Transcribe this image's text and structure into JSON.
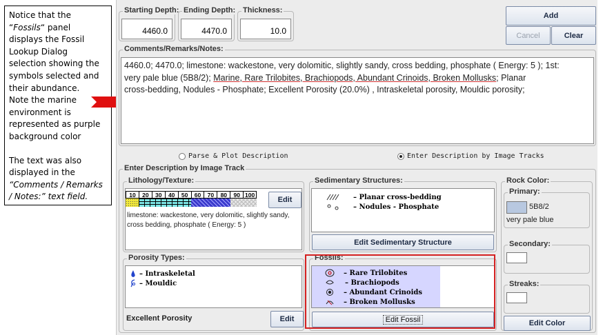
{
  "callout": {
    "l1": "Notice that the",
    "l2a": "“",
    "l2i": "Fossils",
    "l2b": "“ panel",
    "l3": "displays the Fossil",
    "l4": "Lookup Dialog",
    "l5": "selection showing the",
    "l6": "symbols selected and",
    "l7": "their abundance.",
    "l8": "Note the marine",
    "l9": "environment is",
    "l10": "represented as purple",
    "l11": "background color",
    "l12": "The  text was also",
    "l13": "displayed in the",
    "l14": "“Comments / Remarks",
    "l15": "/ Notes:” text field."
  },
  "depth": {
    "starting_label": "Starting Depth:",
    "starting_value": "4460.0",
    "ending_label": "Ending Depth:",
    "ending_value": "4470.0",
    "thickness_label": "Thickness:",
    "thickness_value": "10.0"
  },
  "buttons": {
    "add": "Add",
    "cancel": "Cancel",
    "clear": "Clear",
    "edit": "Edit",
    "edit_sedimentary": "Edit Sedimentary Structure",
    "edit_fossil": "Edit Fossil",
    "edit_color": "Edit Color"
  },
  "comments": {
    "label": "Comments/Remarks/Notes:",
    "line1": "4460.0; 4470.0; limestone:  wackestone, very dolomitic, slightly sandy, cross bedding, phosphate ( Energy: 5 ); 1st:",
    "line2a": "very pale blue (5B8/2); ",
    "line2b": "Marine, Rare Trilobites, Brachiopods, Abundant Crinoids, Broken Mollusks",
    "line2c": "; Planar",
    "line3": "cross-bedding, Nodules - Phosphate; Excellent Porosity (20.0%) , Intraskeletal porosity, Mouldic porosity;"
  },
  "mode": {
    "parse": "Parse & Plot Description",
    "image": "Enter Description by Image Tracks",
    "selected": "image"
  },
  "image_track": {
    "label": "Enter Description by Image Track"
  },
  "lithology": {
    "label": "Lithology/Texture:",
    "scale": [
      "10",
      "20",
      "30",
      "40",
      "50",
      "60",
      "70",
      "80",
      "90",
      "100"
    ],
    "description": "limestone:  wackestone, very dolomitic, slightly sandy, cross bedding, phosphate ( Energy: 5 )"
  },
  "sedimentary": {
    "label": "Sedimentary Structures:",
    "items": [
      "– Planar cross-bedding",
      "– Nodules - Phosphate"
    ]
  },
  "rock_color": {
    "label": "Rock Color:",
    "primary_label": "Primary:",
    "primary_code": "5B8/2",
    "primary_name": "very pale blue",
    "primary_swatch": "#b8c8e0",
    "secondary_label": "Secondary:",
    "streaks_label": "Streaks:"
  },
  "porosity": {
    "label": "Porosity Types:",
    "items": [
      "– Intraskeletal",
      "– Mouldic"
    ],
    "summary": "Excellent Porosity"
  },
  "fossils": {
    "label": "Fossils:",
    "background": "#d6d6ff",
    "items": [
      "– Rare Trilobites",
      "– Brachiopods",
      "– Abundant Crinoids",
      "– Broken Mollusks"
    ]
  },
  "colors": {
    "highlight": "#d42020",
    "arrow": "#e01010",
    "panel": "#ececec"
  }
}
